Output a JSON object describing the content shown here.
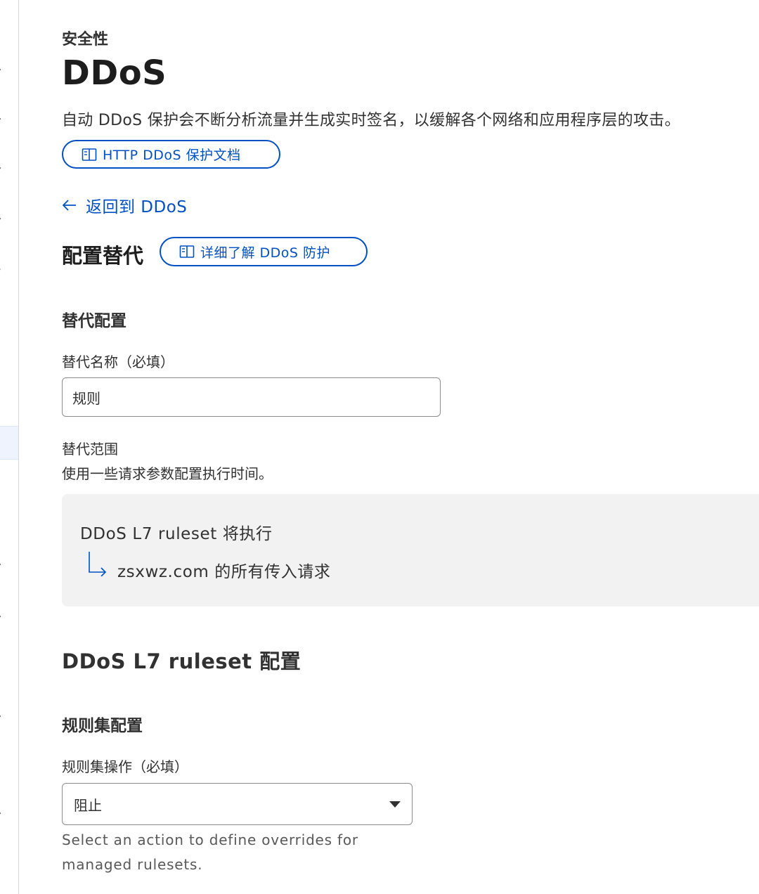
{
  "header": {
    "eyebrow": "安全性",
    "title": "DDoS",
    "description": "自动 DDoS 保护会不断分析流量并生成实时签名，以缓解各个网络和应用程序层的攻击。",
    "docs_link": "HTTP DDoS 保护文档"
  },
  "back_link": "返回到 DDoS",
  "config_override": {
    "title": "配置替代",
    "learn_more": "详细了解 DDoS 防护"
  },
  "override_config": {
    "section_title": "替代配置",
    "name_label": "替代名称（必填）",
    "name_value": "规则",
    "scope_label": "替代范围",
    "scope_help": "使用一些请求参数配置执行时间。",
    "scope_ruleset": "DDoS L7 ruleset",
    "scope_will_execute": "将执行",
    "scope_target": "zsxwz.com 的所有传入请求"
  },
  "ruleset_config": {
    "title": "DDoS L7 ruleset 配置",
    "section_title": "规则集配置",
    "action_label": "规则集操作（必填）",
    "action_value": "阻止",
    "action_help": "Select an action to define overrides for managed rulesets."
  },
  "colors": {
    "link": "#0051c3",
    "text": "#313131",
    "scope_bg": "#f2f2f2",
    "border": "#8c8c8c"
  }
}
